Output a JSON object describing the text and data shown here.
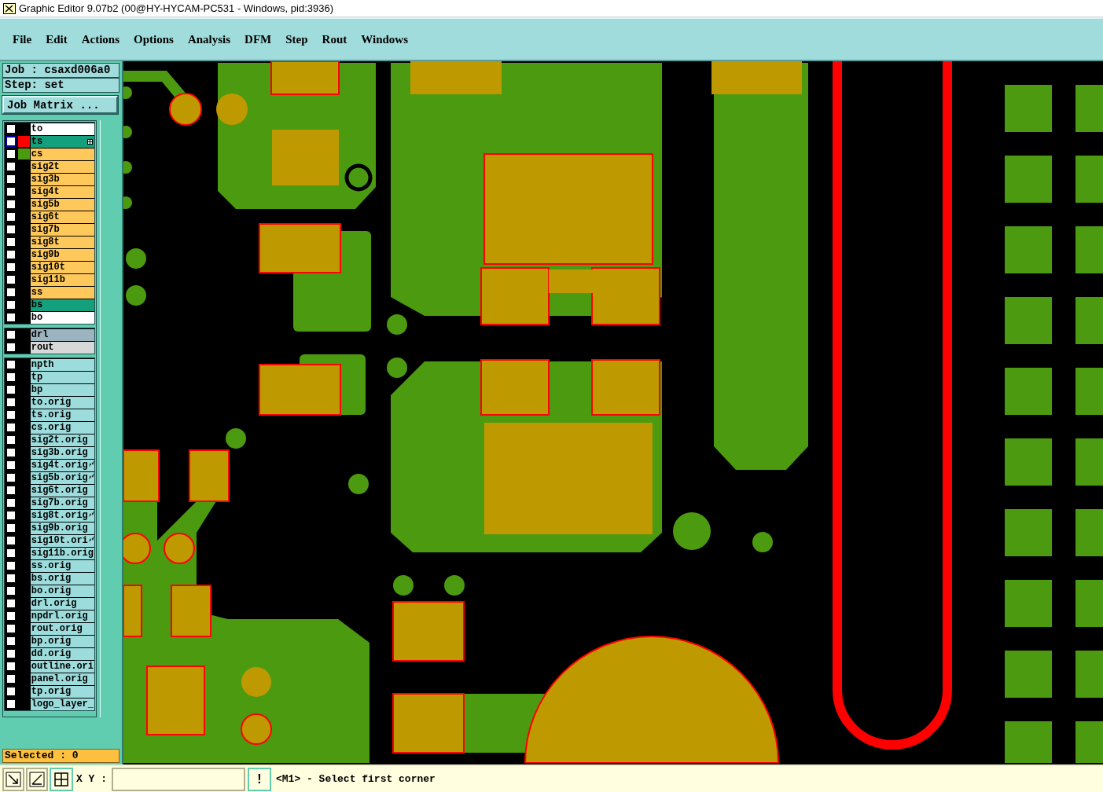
{
  "window": {
    "title": "Graphic Editor 9.07b2 (00@HY-HYCAM-PC531 - Windows, pid:3936)"
  },
  "menu": [
    "File",
    "Edit",
    "Actions",
    "Options",
    "Analysis",
    "DFM",
    "Step",
    "Rout",
    "Windows"
  ],
  "job": "Job : csaxd006a0",
  "step": "Step: set",
  "job_matrix_button": "Job Matrix ...",
  "layer_groups": [
    [
      {
        "name": "to",
        "kind": "silk_screen",
        "checked": false
      },
      {
        "name": "ts",
        "kind": "solder_mask",
        "checked": false,
        "work": true,
        "color": "#ff0000"
      },
      {
        "name": "cs",
        "kind": "signal",
        "checked": false,
        "color": "#4c9a10"
      },
      {
        "name": "sig2t",
        "kind": "signal",
        "checked": false
      },
      {
        "name": "sig3b",
        "kind": "signal",
        "checked": false
      },
      {
        "name": "sig4t",
        "kind": "signal",
        "checked": false
      },
      {
        "name": "sig5b",
        "kind": "signal",
        "checked": false
      },
      {
        "name": "sig6t",
        "kind": "signal",
        "checked": false
      },
      {
        "name": "sig7b",
        "kind": "signal",
        "checked": false
      },
      {
        "name": "sig8t",
        "kind": "signal",
        "checked": false
      },
      {
        "name": "sig9b",
        "kind": "signal",
        "checked": false
      },
      {
        "name": "sig10t",
        "kind": "signal",
        "checked": false
      },
      {
        "name": "sig11b",
        "kind": "signal",
        "checked": false
      },
      {
        "name": "ss",
        "kind": "signal",
        "checked": false
      },
      {
        "name": "bs",
        "kind": "solder_mask",
        "checked": false
      },
      {
        "name": "bo",
        "kind": "silk_screen",
        "checked": false
      }
    ],
    [
      {
        "name": "drl",
        "kind": "drill",
        "checked": false
      },
      {
        "name": "rout",
        "kind": "rout",
        "checked": false
      }
    ],
    [
      {
        "name": "npth",
        "kind": "misc",
        "checked": false
      },
      {
        "name": "tp",
        "kind": "misc",
        "checked": false
      },
      {
        "name": "bp",
        "kind": "misc",
        "checked": false
      },
      {
        "name": "to.orig",
        "kind": "misc",
        "checked": false
      },
      {
        "name": "ts.orig",
        "kind": "misc",
        "checked": false
      },
      {
        "name": "cs.orig",
        "kind": "misc",
        "checked": false
      },
      {
        "name": "sig2t.orig",
        "kind": "misc",
        "checked": false
      },
      {
        "name": "sig3b.orig",
        "kind": "misc",
        "checked": false
      },
      {
        "name": "sig4t.orig",
        "kind": "misc",
        "checked": false,
        "flagged": true
      },
      {
        "name": "sig5b.orig",
        "kind": "misc",
        "checked": false,
        "flagged": true
      },
      {
        "name": "sig6t.orig",
        "kind": "misc",
        "checked": false
      },
      {
        "name": "sig7b.orig",
        "kind": "misc",
        "checked": false
      },
      {
        "name": "sig8t.orig",
        "kind": "misc",
        "checked": false,
        "flagged": true
      },
      {
        "name": "sig9b.orig",
        "kind": "misc",
        "checked": false
      },
      {
        "name": "sig10t.ori",
        "kind": "misc",
        "checked": false,
        "flagged": true
      },
      {
        "name": "sig11b.orig",
        "kind": "misc",
        "checked": false
      },
      {
        "name": "ss.orig",
        "kind": "misc",
        "checked": false
      },
      {
        "name": "bs.orig",
        "kind": "misc",
        "checked": false
      },
      {
        "name": "bo.orig",
        "kind": "misc",
        "checked": false
      },
      {
        "name": "drl.orig",
        "kind": "misc",
        "checked": false
      },
      {
        "name": "npdrl.orig",
        "kind": "misc",
        "checked": false
      },
      {
        "name": "rout.orig",
        "kind": "misc",
        "checked": false
      },
      {
        "name": "bp.orig",
        "kind": "misc",
        "checked": false
      },
      {
        "name": "dd.orig",
        "kind": "misc",
        "checked": false
      },
      {
        "name": "outline.ori",
        "kind": "misc",
        "checked": false
      },
      {
        "name": "panel.orig",
        "kind": "misc",
        "checked": false
      },
      {
        "name": "tp.orig",
        "kind": "misc",
        "checked": false
      },
      {
        "name": "logo_layer_",
        "kind": "misc",
        "checked": false
      }
    ]
  ],
  "selected_count": "Selected : 0",
  "status_bar": {
    "xy_label": "X Y :",
    "alert_button": "!",
    "message": "<M1> - Select first corner"
  }
}
